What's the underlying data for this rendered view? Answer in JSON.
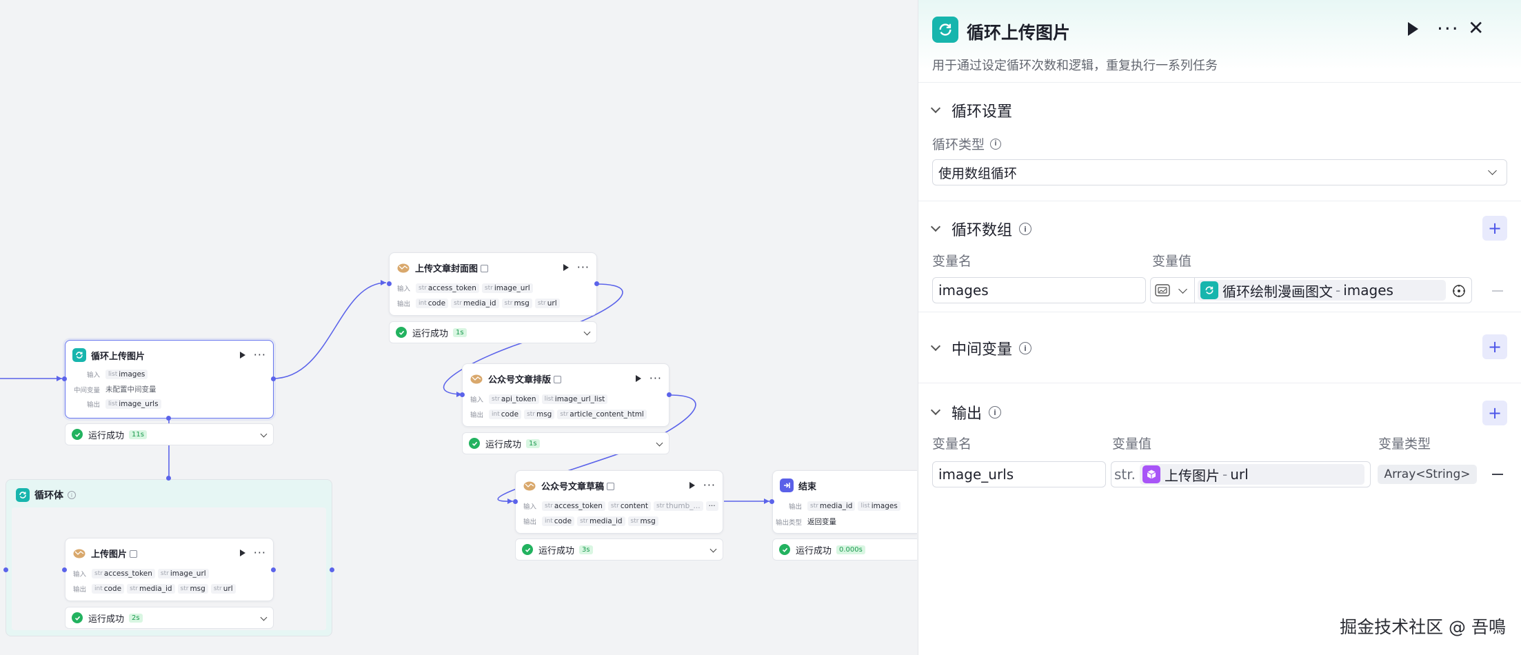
{
  "canvas": {
    "loop_node": {
      "title": "循环上传图片",
      "input_label": "输入",
      "input_var": {
        "type": "list",
        "name": "images"
      },
      "mid_label": "中间变量",
      "mid_value": "未配置中间变量",
      "output_label": "输出",
      "output_var": {
        "type": "list",
        "name": "image_urls"
      },
      "status": "运行成功",
      "time": "11s"
    },
    "loop_body": {
      "title": "循环体",
      "info_glyph": "i"
    },
    "upload_image": {
      "title": "上传图片",
      "input_label": "输入",
      "inputs": [
        {
          "type": "str",
          "name": "access_token"
        },
        {
          "type": "str",
          "name": "image_url"
        }
      ],
      "output_label": "输出",
      "outputs": [
        {
          "type": "int",
          "name": "code"
        },
        {
          "type": "str",
          "name": "media_id"
        },
        {
          "type": "str",
          "name": "msg"
        },
        {
          "type": "str",
          "name": "url"
        }
      ],
      "status": "运行成功",
      "time": "2s"
    },
    "upload_cover": {
      "title": "上传文章封面图",
      "input_label": "输入",
      "inputs": [
        {
          "type": "str",
          "name": "access_token"
        },
        {
          "type": "str",
          "name": "image_url"
        }
      ],
      "output_label": "输出",
      "outputs": [
        {
          "type": "int",
          "name": "code"
        },
        {
          "type": "str",
          "name": "media_id"
        },
        {
          "type": "str",
          "name": "msg"
        },
        {
          "type": "str",
          "name": "url"
        }
      ],
      "status": "运行成功",
      "time": "1s"
    },
    "layout_node": {
      "title": "公众号文章排版",
      "input_label": "输入",
      "inputs": [
        {
          "type": "str",
          "name": "api_token"
        },
        {
          "type": "list",
          "name": "image_url_list"
        }
      ],
      "output_label": "输出",
      "outputs": [
        {
          "type": "int",
          "name": "code"
        },
        {
          "type": "str",
          "name": "msg"
        },
        {
          "type": "str",
          "name": "article_content_html"
        }
      ],
      "status": "运行成功",
      "time": "1s"
    },
    "draft_node": {
      "title": "公众号文章草稿",
      "input_label": "输入",
      "inputs": [
        {
          "type": "str",
          "name": "access_token"
        },
        {
          "type": "str",
          "name": "content"
        },
        {
          "type": "str",
          "name": "thumb_..."
        }
      ],
      "more_inputs": "···",
      "output_label": "输出",
      "outputs": [
        {
          "type": "int",
          "name": "code"
        },
        {
          "type": "str",
          "name": "media_id"
        },
        {
          "type": "str",
          "name": "msg"
        }
      ],
      "status": "运行成功",
      "time": "3s"
    },
    "end_node": {
      "title": "结束",
      "output_label": "输出",
      "outputs": [
        {
          "type": "str",
          "name": "media_id"
        },
        {
          "type": "list",
          "name": "images"
        }
      ],
      "output_type_label": "输出类型",
      "output_type_value": "返回变量",
      "status": "运行成功",
      "time": "0.000s"
    }
  },
  "panel": {
    "title": "循环上传图片",
    "description": "用于通过设定循环次数和逻辑，重复执行一系列任务",
    "loop_settings": {
      "heading": "循环设置",
      "type_label": "循环类型",
      "type_value": "使用数组循环"
    },
    "loop_array": {
      "heading": "循环数组",
      "col_name": "变量名",
      "col_value": "变量值",
      "row": {
        "name": "images",
        "ref_node": "循环绘制漫画图文",
        "ref_sep": "-",
        "ref_var": "images"
      }
    },
    "mid_vars": {
      "heading": "中间变量"
    },
    "output": {
      "heading": "输出",
      "col_name": "变量名",
      "col_value": "变量值",
      "col_type": "变量类型",
      "row": {
        "name": "image_urls",
        "prefix": "str.",
        "ref_node": "上传图片",
        "ref_sep": "-",
        "ref_var": "url",
        "type": "Array<String>"
      }
    },
    "add_glyph": "+",
    "watermark": "掘金技术社区 @ 吾鳴"
  },
  "colors": {
    "accent": "#5b63ea",
    "loop_teal": "#17b5ad",
    "success": "#22b25f",
    "ref_purple": "#a855f7"
  },
  "icons": [
    "loop-icon",
    "plugin-icon",
    "end-icon",
    "play-icon",
    "more-icon",
    "close-icon",
    "chevron-down-icon",
    "info-icon",
    "plus-icon",
    "image-icon",
    "target-icon",
    "cube-icon",
    "check-icon"
  ]
}
